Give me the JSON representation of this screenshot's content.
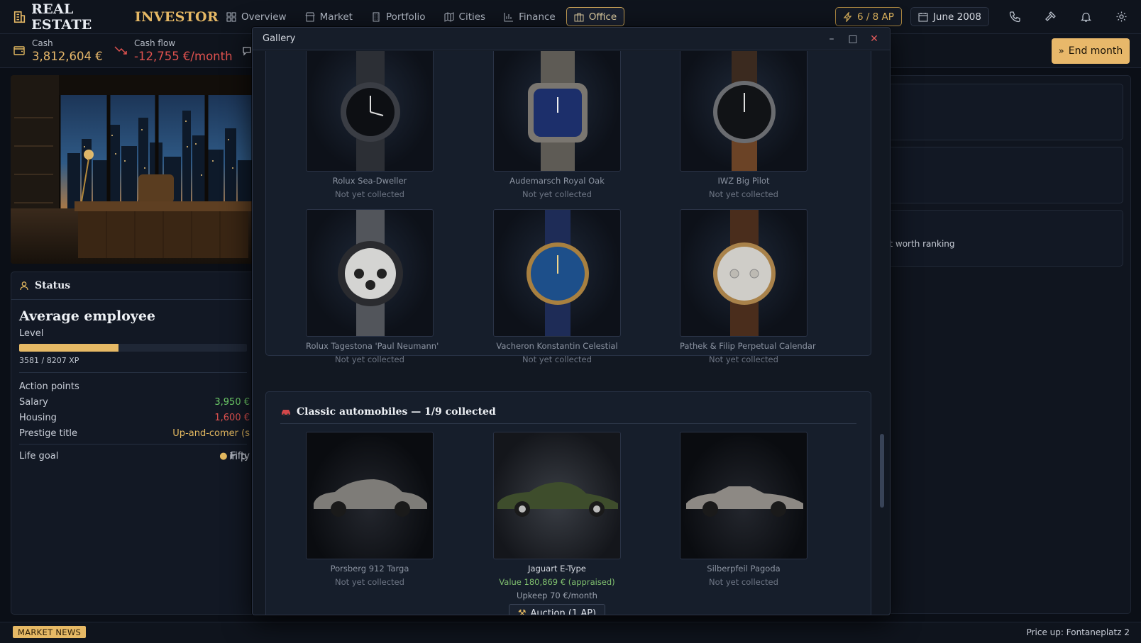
{
  "brand": {
    "part1": "REAL ESTATE",
    "part2": "INVESTOR"
  },
  "nav": {
    "tabs": [
      {
        "label": "Overview"
      },
      {
        "label": "Market"
      },
      {
        "label": "Portfolio"
      },
      {
        "label": "Cities"
      },
      {
        "label": "Finance"
      },
      {
        "label": "Office"
      }
    ]
  },
  "header": {
    "ap": "6 / 8 AP",
    "date": "June 2008"
  },
  "stats": {
    "cash_label": "Cash",
    "cash_value": "3,812,604 €",
    "cashflow_label": "Cash flow",
    "cashflow_value": "-12,755 €/month"
  },
  "end_month": "End month",
  "status": {
    "heading": "Status",
    "title": "Average employee",
    "level_label": "Level",
    "xp_text": "3581 / 8207 XP",
    "xp_fraction": 0.436,
    "rows": [
      {
        "label": "Action points",
        "value": ""
      },
      {
        "label": "Salary",
        "value": "3,950 €"
      },
      {
        "label": "Housing",
        "value": "1,600 €"
      },
      {
        "label": "Prestige title",
        "value": "Up-and-comer (s"
      }
    ],
    "life_goal_label": "Life goal",
    "life_goal_value": "Fifty",
    "life_goal_value2": "in p"
  },
  "right_fragment": "et worth ranking",
  "gallery": {
    "title": "Gallery",
    "watches": [
      {
        "name": "Rolux Sea-Dweller",
        "status": "Not yet collected"
      },
      {
        "name": "Audemarsch Royal Oak",
        "status": "Not yet collected"
      },
      {
        "name": "IWZ Big Pilot",
        "status": "Not yet collected"
      },
      {
        "name": "Rolux Tagestona 'Paul Neumann'",
        "status": "Not yet collected"
      },
      {
        "name": "Vacheron Konstantin Celestial",
        "status": "Not yet collected"
      },
      {
        "name": "Pathek & Filip Perpetual Calendar",
        "status": "Not yet collected"
      }
    ],
    "cars_heading": "Classic automobiles — 1/9 collected",
    "cars": [
      {
        "name": "Porsberg 912 Targa",
        "status": "Not yet collected"
      },
      {
        "name": "Jaguart E-Type",
        "value": "Value 180,869 € (appraised)",
        "upkeep": "Upkeep 70 €/month",
        "action": "Auction (1 AP)"
      },
      {
        "name": "Silberpfeil Pagoda",
        "status": "Not yet collected"
      }
    ]
  },
  "footer": {
    "news_label": "MARKET NEWS",
    "ticker": "Price up: Fontaneplatz 2"
  },
  "colors": {
    "accent": "#e6b965",
    "positive": "#6fcf6a",
    "negative": "#e0524f",
    "panel": "#121824"
  }
}
